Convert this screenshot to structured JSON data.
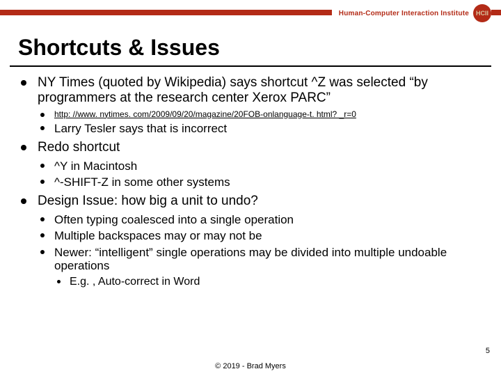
{
  "header": {
    "institute_label": "Human-Computer Interaction Institute",
    "logo_text": "HCII"
  },
  "slide": {
    "title": "Shortcuts & Issues",
    "page_number": "5",
    "copyright": "© 2019 - Brad Myers"
  },
  "bullets": {
    "b1": {
      "text": "NY Times (quoted by Wikipedia) says shortcut ^Z was selected “by programmers at the research center Xerox PARC”",
      "sub": {
        "s1_url": "http: //www. nytimes. com/2009/09/20/magazine/20FOB-onlanguage-t. html? _r=0",
        "s2": "Larry Tesler says that is incorrect"
      }
    },
    "b2": {
      "text": "Redo shortcut",
      "sub": {
        "s1": "^Y in Macintosh",
        "s2": "^-SHIFT-Z in some other systems"
      }
    },
    "b3": {
      "text": "Design Issue: how big a unit to undo?",
      "sub": {
        "s1": "Often typing coalesced into a single operation",
        "s2": "Multiple backspaces may or may not be",
        "s3": "Newer: “intelligent” single operations may be divided into multiple undoable operations",
        "s3sub": {
          "t1": "E.g. , Auto-correct in Word"
        }
      }
    }
  }
}
